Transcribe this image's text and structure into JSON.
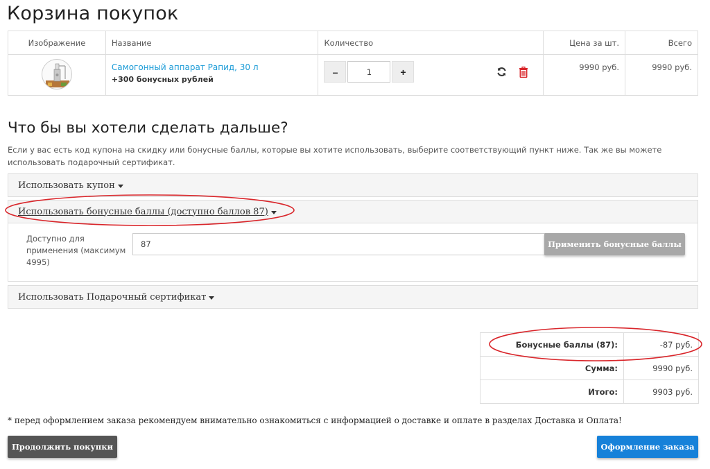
{
  "page": {
    "title": "Корзина покупок"
  },
  "cart": {
    "headers": {
      "image": "Изображение",
      "name": "Название",
      "quantity": "Количество",
      "unit_price": "Цена за шт.",
      "total": "Всего"
    },
    "items": [
      {
        "name": "Самогонный аппарат Рапид, 30 л",
        "bonus": "+300 бонусных рублей",
        "quantity": "1",
        "unit_price": "9990 руб.",
        "total": "9990 руб."
      }
    ],
    "qty_minus": "–",
    "qty_plus": "+",
    "icons": {
      "refresh": "refresh-icon",
      "delete": "trash-icon"
    }
  },
  "next": {
    "title": "Что бы вы хотели сделать дальше?",
    "description": "Если у вас есть код купона на скидку или бонусные баллы, которые вы хотите использовать, выберите соответствующий пункт ниже. Так же вы можете использовать подарочный сертификат.",
    "coupon_label": "Использовать купон",
    "bonus_label": "Использовать бонусные баллы (доступно баллов 87)",
    "bonus_field_label": "Доступно для применения (максимум 4995)",
    "bonus_value": "87",
    "bonus_apply": "Применить бонусные баллы",
    "gift_label": "Использовать Подарочный сертификат"
  },
  "totals": [
    {
      "label": "Бонусные баллы (87):",
      "value": "-87 руб."
    },
    {
      "label": "Сумма:",
      "value": "9990 руб."
    },
    {
      "label": "Итого:",
      "value": "9903 руб."
    }
  ],
  "note": "* перед оформлением заказа рекомендуем внимательно ознакомиться с информацией о доставке и оплате в разделах Доставка и Оплата!",
  "buttons": {
    "continue": "Продолжить покупки",
    "checkout": "Оформление заказа"
  },
  "colors": {
    "link": "#1a9bd7",
    "checkout": "#1681d9",
    "annotation": "#d9262b",
    "delete_icon": "#d9262b"
  }
}
